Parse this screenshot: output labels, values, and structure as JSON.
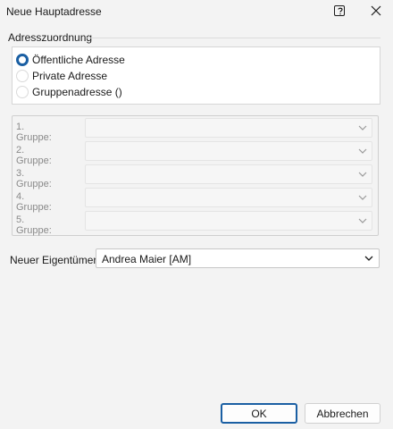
{
  "window": {
    "title": "Neue Hauptadresse"
  },
  "assignment": {
    "label": "Adresszuordnung",
    "options": [
      {
        "label": "Öffentliche Adresse",
        "checked": true
      },
      {
        "label": "Private Adresse",
        "checked": false
      },
      {
        "label": "Gruppenadresse ()",
        "checked": false
      }
    ]
  },
  "groups": [
    {
      "label": "1. Gruppe:",
      "value": ""
    },
    {
      "label": "2. Gruppe:",
      "value": ""
    },
    {
      "label": "3. Gruppe:",
      "value": ""
    },
    {
      "label": "4. Gruppe:",
      "value": ""
    },
    {
      "label": "5. Gruppe:",
      "value": ""
    }
  ],
  "owner": {
    "label": "Neuer Eigentümer:",
    "value": "Andrea Maier [AM]"
  },
  "buttons": {
    "ok": "OK",
    "cancel": "Abbrechen"
  },
  "colors": {
    "accent": "#1a5fa3",
    "background": "#f3f3f3"
  }
}
